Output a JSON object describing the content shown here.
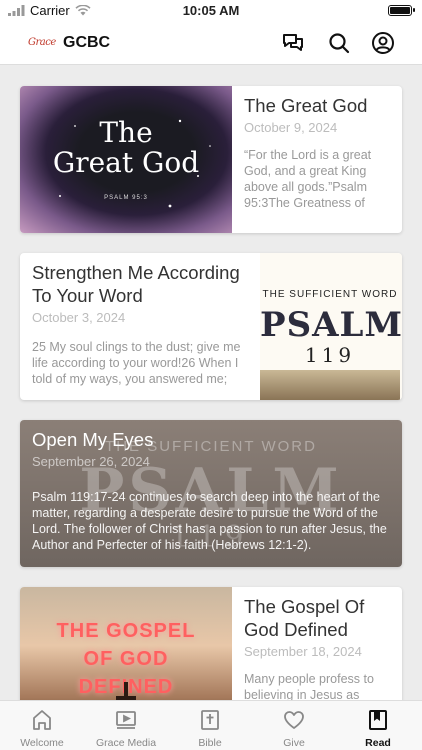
{
  "status_bar": {
    "carrier": "Carrier",
    "time": "10:05 AM"
  },
  "header": {
    "logo_text": "Grace",
    "title": "GCBC"
  },
  "cards": [
    {
      "title": "The Great God",
      "date": "October 9, 2024",
      "excerpt": "“For the Lord is a great God, and a great King above all gods.”Psalm 95:3The Greatness of God",
      "thumb": {
        "line1": "The",
        "line2": "Great God",
        "ref": "PSALM 95:3"
      }
    },
    {
      "title": "Strengthen Me According To Your Word",
      "date": "October 3, 2024",
      "excerpt": "25 My soul clings to the dust; give me life according to your word!26 When I told of my ways, you answered me; teach",
      "thumb": {
        "top": "THE SUFFICIENT WORD",
        "main": "PSALM",
        "num": "119"
      }
    },
    {
      "title": "Open My Eyes",
      "date": "September 26, 2024",
      "excerpt": "Psalm 119:17-24 continues to search deep into the heart of the matter, regarding a desperate desire to pursue the Word of the Lord. The follower of Christ has a passion to run after Jesus, the Author and Perfecter of his faith (Hebrews 12:1-2).",
      "bg": {
        "top": "THE SUFFICIENT WORD",
        "main": "PSALM",
        "num": "119"
      }
    },
    {
      "title": "The Gospel Of God Defined",
      "date": "September 18, 2024",
      "excerpt": "Many people profess to believing in Jesus as",
      "thumb": {
        "line1": "THE GOSPEL",
        "line2": "OF GOD",
        "line3": "DEFINED"
      }
    }
  ],
  "tabs": [
    {
      "label": "Welcome",
      "icon": "home-icon"
    },
    {
      "label": "Grace Media",
      "icon": "video-icon"
    },
    {
      "label": "Bible",
      "icon": "bible-icon"
    },
    {
      "label": "Give",
      "icon": "heart-icon"
    },
    {
      "label": "Read",
      "icon": "book-icon",
      "active": true
    }
  ],
  "colors": {
    "accent": "#111111",
    "inactive_tab": "#888888",
    "background": "#ececec"
  }
}
